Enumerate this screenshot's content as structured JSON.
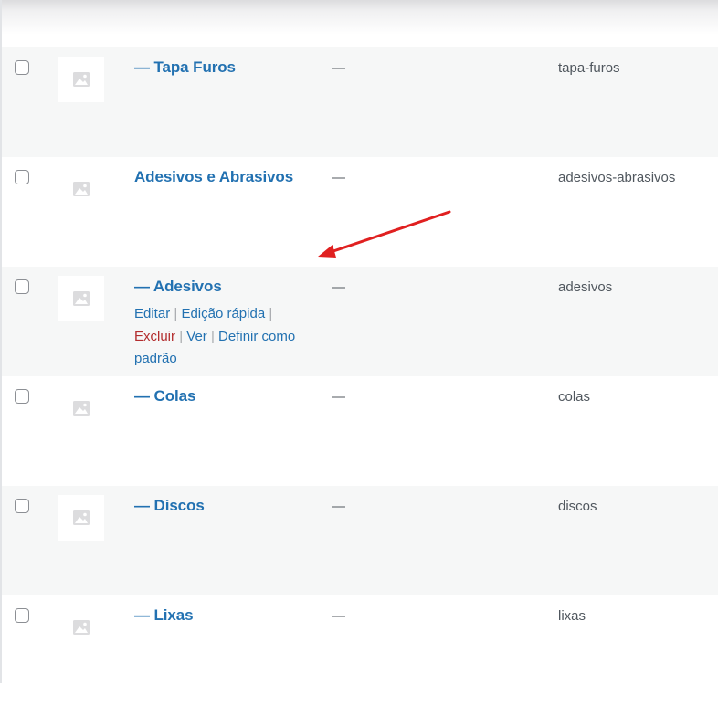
{
  "rows": [
    {
      "name": "— Tapa Furos",
      "description": "—",
      "slug": "tapa-furos"
    },
    {
      "name": "Adesivos e Abrasivos",
      "description": "—",
      "slug": "adesivos-abrasivos"
    },
    {
      "name": "— Adesivos",
      "description": "—",
      "slug": "adesivos"
    },
    {
      "name": "— Colas",
      "description": "—",
      "slug": "colas"
    },
    {
      "name": "— Discos",
      "description": "—",
      "slug": "discos"
    },
    {
      "name": "— Lixas",
      "description": "—",
      "slug": "lixas"
    }
  ],
  "row_actions": {
    "edit": "Editar",
    "quick_edit": "Edição rápida",
    "delete": "Excluir",
    "view": "Ver",
    "make_default": "Definir como padrão",
    "separator": "|"
  },
  "colors": {
    "link": "#2271b1",
    "delete": "#b32d2e",
    "alt_row": "#f6f7f7",
    "arrow": "#e02020"
  },
  "icons": {
    "thumbnail": "image-placeholder-icon",
    "annotation": "red-arrow-icon"
  }
}
